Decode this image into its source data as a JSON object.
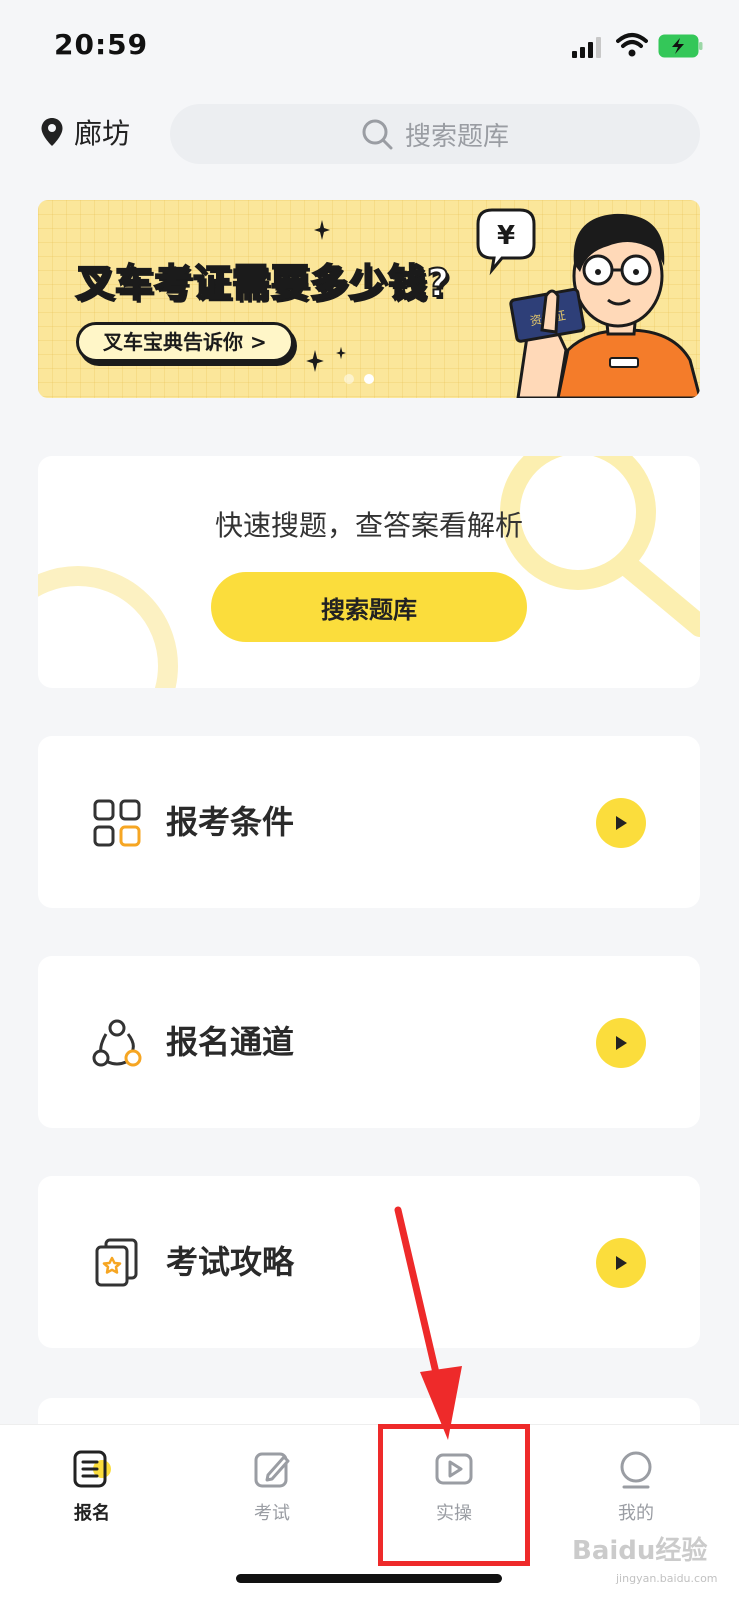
{
  "status_bar": {
    "time": "20:59"
  },
  "header": {
    "location": "廊坊",
    "search_placeholder": "搜索题库"
  },
  "banner": {
    "headline": "叉车考证需要多少钱?",
    "subline": "叉车宝典告诉你 >",
    "bubble_currency": "¥",
    "bubble_question": "?",
    "card_text": "资格证",
    "pages": 2,
    "active_page": 2
  },
  "quick_search": {
    "title": "快速搜题，查答案看解析",
    "button_label": "搜索题库"
  },
  "menu": [
    {
      "label": "报考条件",
      "icon": "grid-apps-icon"
    },
    {
      "label": "报名通道",
      "icon": "network-nodes-icon"
    },
    {
      "label": "考试攻略",
      "icon": "cards-star-icon"
    }
  ],
  "tab_bar": {
    "tabs": [
      {
        "label": "报名",
        "icon": "register-list-icon",
        "active": true
      },
      {
        "label": "考试",
        "icon": "pencil-note-icon",
        "active": false
      },
      {
        "label": "实操",
        "icon": "play-video-icon",
        "active": false
      },
      {
        "label": "我的",
        "icon": "profile-icon",
        "active": false
      }
    ]
  },
  "colors": {
    "accent_yellow": "#fbdd3c",
    "banner_bg": "#fbe69a",
    "annotation_red": "#ee2a2a",
    "page_bg": "#f5f6f8"
  },
  "watermark": {
    "brand": "Baidu经验",
    "url": "jingyan.baidu.com"
  }
}
